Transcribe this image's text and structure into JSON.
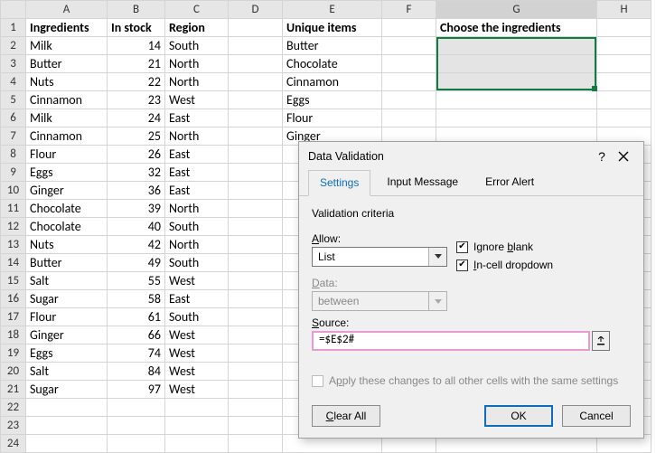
{
  "columns": [
    "A",
    "B",
    "C",
    "D",
    "E",
    "F",
    "G",
    "H"
  ],
  "headers": {
    "A": "Ingredients",
    "B": "In stock",
    "C": "Region",
    "E": "Unique items",
    "G": "Choose the ingredients"
  },
  "rows": [
    {
      "A": "Milk",
      "B": 14,
      "C": "South",
      "E": "Butter"
    },
    {
      "A": "Butter",
      "B": 21,
      "C": "North",
      "E": "Chocolate"
    },
    {
      "A": "Nuts",
      "B": 22,
      "C": "North",
      "E": "Cinnamon"
    },
    {
      "A": "Cinnamon",
      "B": 23,
      "C": "West",
      "E": "Eggs"
    },
    {
      "A": "Milk",
      "B": 24,
      "C": "East",
      "E": "Flour"
    },
    {
      "A": "Cinnamon",
      "B": 25,
      "C": "North",
      "E": "Ginger"
    },
    {
      "A": "Flour",
      "B": 26,
      "C": "East"
    },
    {
      "A": "Eggs",
      "B": 32,
      "C": "East"
    },
    {
      "A": "Ginger",
      "B": 36,
      "C": "East"
    },
    {
      "A": "Chocolate",
      "B": 39,
      "C": "North"
    },
    {
      "A": "Chocolate",
      "B": 40,
      "C": "South"
    },
    {
      "A": "Nuts",
      "B": 42,
      "C": "North"
    },
    {
      "A": "Butter",
      "B": 49,
      "C": "South"
    },
    {
      "A": "Salt",
      "B": 55,
      "C": "West"
    },
    {
      "A": "Sugar",
      "B": 58,
      "C": "East"
    },
    {
      "A": "Flour",
      "B": 61,
      "C": "South"
    },
    {
      "A": "Ginger",
      "B": 66,
      "C": "West"
    },
    {
      "A": "Eggs",
      "B": 74,
      "C": "West"
    },
    {
      "A": "Salt",
      "B": 84,
      "C": "West"
    },
    {
      "A": "Sugar",
      "B": 97,
      "C": "West"
    }
  ],
  "rowCount": 24,
  "dialog": {
    "title": "Data Validation",
    "tabs": {
      "settings": "Settings",
      "input": "Input Message",
      "error": "Error Alert"
    },
    "criteria_label": "Validation criteria",
    "allow_label": "Allow:",
    "allow_value": "List",
    "data_label": "Data:",
    "data_value": "between",
    "ignore_blank": "Ignore blank",
    "incell": "In-cell dropdown",
    "source_label": "Source:",
    "source_value": "=$E$2#",
    "apply_all": "Apply these changes to all other cells with the same settings",
    "clear": "Clear All",
    "ok": "OK",
    "cancel": "Cancel"
  }
}
